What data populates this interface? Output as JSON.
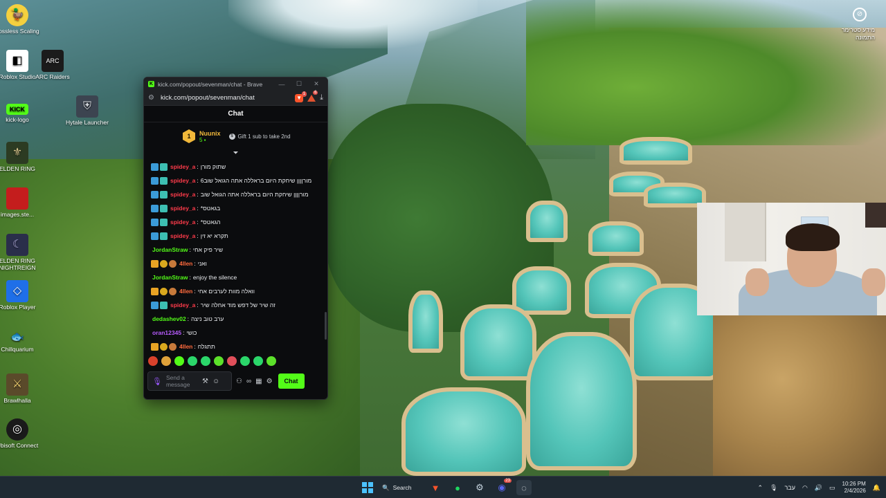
{
  "desktop": {
    "icons": [
      {
        "label": "Lossless Scaling",
        "name": "lossless-scaling-icon"
      },
      {
        "label": "Roblox Studio",
        "name": "roblox-studio-icon"
      },
      {
        "label": "ARC Raiders",
        "name": "arc-raiders-icon"
      },
      {
        "label": "kick-logo",
        "name": "kick-logo-icon"
      },
      {
        "label": "Hytale Launcher",
        "name": "hytale-launcher-icon"
      },
      {
        "label": "ELDEN RING",
        "name": "elden-ring-icon"
      },
      {
        "label": "images.ste...",
        "name": "images-ste-icon"
      },
      {
        "label": "ELDEN RING NIGHTREIGN",
        "name": "elden-ring-nightreign-icon"
      },
      {
        "label": "Roblox Player",
        "name": "roblox-player-icon"
      },
      {
        "label": "Chillquarium",
        "name": "chillquarium-icon"
      },
      {
        "label": "Brawlhalla",
        "name": "brawlhalla-icon"
      },
      {
        "label": "Ubisoft Connect",
        "name": "ubisoft-connect-icon"
      }
    ],
    "stream_overlay": "מידע סטרימר התמונה"
  },
  "browser": {
    "title": "kick.com/popout/sevenman/chat - Brave",
    "url": "kick.com/popout/sevenman/chat",
    "brave_badge": "1",
    "rewards_badge": "6"
  },
  "chat": {
    "header": "Chat",
    "pinned": {
      "rank": "1",
      "user": "Nuunix",
      "count": "5",
      "gift_text": "Gift 1 sub to take 2nd"
    },
    "messages": [
      {
        "user": "spidey_a",
        "text": "שתוק מורן",
        "color": "red",
        "badges": [
          "blue",
          "teal"
        ]
      },
      {
        "user": "spidey_a",
        "text": "מורןןןן שיחקת היום בראללה אתה הגואל שוב6",
        "color": "red",
        "badges": [
          "blue",
          "teal"
        ]
      },
      {
        "user": "spidey_a",
        "text": "מורןןןן שיחקת היום בראללה אתה הגואל שוב",
        "color": "red",
        "badges": [
          "blue",
          "teal"
        ]
      },
      {
        "user": "spidey_a",
        "text": "*בגאטס",
        "color": "red",
        "badges": [
          "blue",
          "teal"
        ]
      },
      {
        "user": "spidey_a",
        "text": "*הגאטס",
        "color": "red",
        "badges": [
          "blue",
          "teal"
        ]
      },
      {
        "user": "spidey_a",
        "text": "תקרא יא זין",
        "color": "red",
        "badges": [
          "blue",
          "teal"
        ]
      },
      {
        "user": "JordanStraw",
        "text": "שיר פיק אחי",
        "color": "green",
        "badges": []
      },
      {
        "user": "4llen",
        "text": "ואני",
        "color": "orange",
        "badges": [
          "crown",
          "coin",
          "avatar"
        ]
      },
      {
        "user": "JordanStraw",
        "text": "enjoy the silence",
        "color": "green",
        "badges": []
      },
      {
        "user": "4llen",
        "text": "וואלה מוות לערבים אחי",
        "color": "orange",
        "badges": [
          "crown",
          "coin",
          "avatar"
        ]
      },
      {
        "user": "spidey_a",
        "text": "זה שיר של דפש מוד אחלה שיר",
        "color": "red",
        "badges": [
          "blue",
          "teal"
        ]
      },
      {
        "user": "dedashev02",
        "text": "ערב טוב ניצה",
        "color": "green",
        "badges": []
      },
      {
        "user": "oran12345",
        "text": "כושי",
        "color": "purple",
        "badges": []
      },
      {
        "user": "4llen",
        "text": "תתגלח",
        "color": "orange",
        "badges": [
          "crown",
          "coin",
          "avatar"
        ]
      }
    ],
    "input_placeholder": "Send a message",
    "send_label": "Chat"
  },
  "taskbar": {
    "search_label": "Search",
    "language": "עבר",
    "time": "10:26 PM",
    "date": "2/4/2026",
    "discord_badge": "23"
  },
  "colors": {
    "kick_green": "#53fc18",
    "user_red": "#ff3b4a",
    "user_purple": "#b85cff",
    "user_orange": "#ff6a3d"
  }
}
